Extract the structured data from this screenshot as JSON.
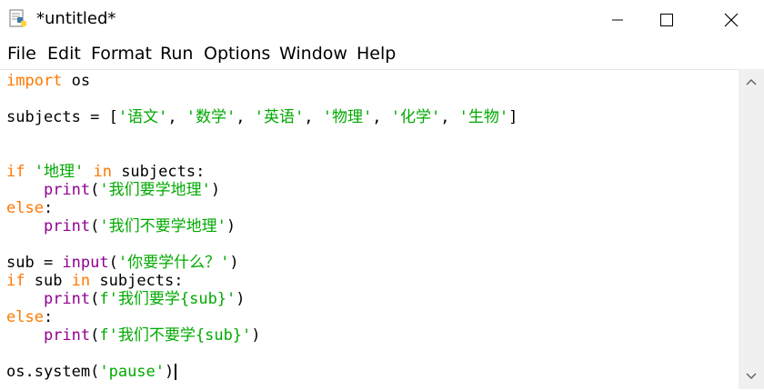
{
  "window": {
    "title": "*untitled*"
  },
  "menu": [
    "File",
    "Edit",
    "Format",
    "Run",
    "Options",
    "Window",
    "Help"
  ],
  "code": {
    "l1": [
      "import",
      " os"
    ],
    "l2": [
      "subjects = [",
      "'语文'",
      ", ",
      "'数学'",
      ", ",
      "'英语'",
      ", ",
      "'物理'",
      ", ",
      "'化学'",
      ", ",
      "'生物'",
      "]"
    ],
    "l3": [
      "if",
      " ",
      "'地理'",
      " ",
      "in",
      " subjects:"
    ],
    "l4": [
      "    ",
      "print",
      "(",
      "'我们要学地理'",
      ")"
    ],
    "l5": [
      "else",
      ":"
    ],
    "l6": [
      "    ",
      "print",
      "(",
      "'我们不要学地理'",
      ")"
    ],
    "l7": [
      "sub = ",
      "input",
      "(",
      "'你要学什么？'",
      ")"
    ],
    "l8": [
      "if",
      " sub ",
      "in",
      " subjects:"
    ],
    "l9": [
      "    ",
      "print",
      "(",
      "f'我们要学{sub}'",
      ")"
    ],
    "l10": [
      "else",
      ":"
    ],
    "l11": [
      "    ",
      "print",
      "(",
      "f'我们不要学{sub}'",
      ")"
    ],
    "l12": [
      "os.system(",
      "'pause'",
      ")"
    ]
  },
  "colors": {
    "keyword": "#ff7700",
    "builtin": "#900090",
    "string": "#00aa00",
    "text": "#000000"
  },
  "icons": {
    "app": "python-idle-icon",
    "min": "minimize-icon",
    "max": "maximize-icon",
    "close": "close-icon"
  }
}
